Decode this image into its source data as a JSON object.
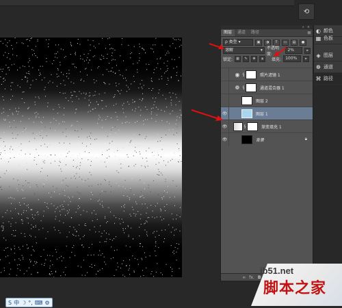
{
  "panel": {
    "tabs": [
      "图层",
      "通道",
      "路径"
    ],
    "filter_kind": "类型",
    "blend_mode": "溶解",
    "opacity_label": "不透明度:",
    "opacity_value": "2%",
    "lock_label": "锁定:",
    "fill_label": "填充:",
    "fill_value": "100%",
    "layers": [
      {
        "name": "照片滤镜 1",
        "visible": false,
        "type": "adjustment",
        "icon": "photo-filter-icon"
      },
      {
        "name": "通道混合器 1",
        "visible": false,
        "type": "adjustment",
        "icon": "channel-mixer-icon"
      },
      {
        "name": "图层 2",
        "visible": false,
        "type": "pixel"
      },
      {
        "name": "图层 1",
        "visible": true,
        "type": "pixel",
        "selected": true
      },
      {
        "name": "渐变填充 1",
        "visible": true,
        "type": "gradient"
      },
      {
        "name": "背景",
        "visible": true,
        "type": "background",
        "locked": true
      }
    ]
  },
  "collapsed_panels": [
    {
      "label": "颜色",
      "icon": "color-palette-icon"
    },
    {
      "label": "色板",
      "icon": "swatches-icon"
    },
    {
      "label": "图层",
      "icon": "layers-icon"
    },
    {
      "label": "通道",
      "icon": "channels-icon"
    },
    {
      "label": "路径",
      "icon": "paths-icon"
    }
  ],
  "watermark": {
    "url": "jb51.net",
    "site": "脚本之家"
  },
  "ime": {
    "lang": "中"
  }
}
